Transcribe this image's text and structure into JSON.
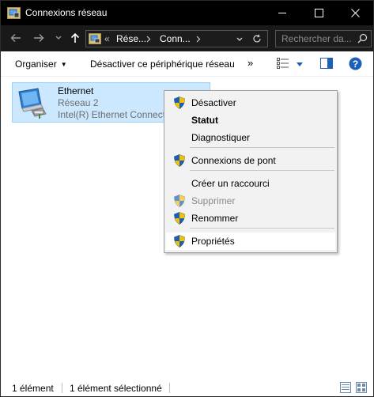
{
  "window": {
    "title": "Connexions réseau",
    "accent": "#000000"
  },
  "address": {
    "overflow": "«",
    "crumbs": [
      "Rése...",
      "Conn..."
    ],
    "search_placeholder": "Rechercher da..."
  },
  "commands": {
    "organize": "Organiser",
    "disable_device": "Désactiver ce périphérique réseau",
    "more": "»"
  },
  "item": {
    "name": "Ethernet",
    "network": "Réseau 2",
    "adapter": "Intel(R) Ethernet Connection"
  },
  "context_menu": {
    "items": [
      {
        "label": "Désactiver",
        "shield": true
      },
      {
        "label": "Statut",
        "bold": true
      },
      {
        "label": "Diagnostiquer"
      },
      {
        "label": "Connexions de pont",
        "shield": true
      },
      {
        "label": "Créer un raccourci"
      },
      {
        "label": "Supprimer",
        "shield": true,
        "disabled": true
      },
      {
        "label": "Renommer",
        "shield": true
      },
      {
        "label": "Propriétés",
        "shield": true,
        "hovered": true
      }
    ]
  },
  "status": {
    "count": "1 élément",
    "selected": "1 élément sélectionné"
  },
  "colors": {
    "selection_bg": "#cce8ff",
    "selection_border": "#99d1ff",
    "shield_blue": "#1c5fb8",
    "shield_yellow": "#f2c200"
  }
}
